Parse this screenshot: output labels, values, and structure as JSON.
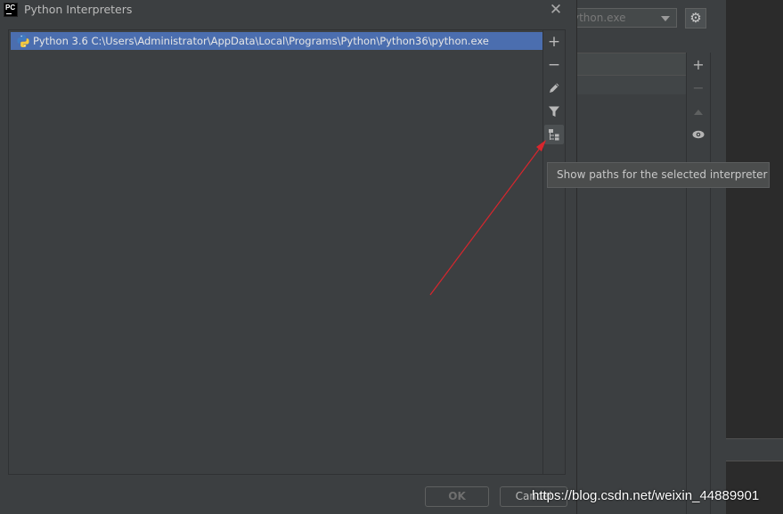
{
  "background_dialog": {
    "interpreter_combo_value": "ython.exe",
    "gear_icon": "gear-icon",
    "toolbar_icons": [
      "plus-icon",
      "minus-icon",
      "up-arrow-icon",
      "eye-icon"
    ]
  },
  "dialog": {
    "title": "Python Interpreters",
    "logo_text": "PC",
    "close_glyph": "✕"
  },
  "interpreters": [
    {
      "label": "Python 3.6 C:\\Users\\Administrator\\AppData\\Local\\Programs\\Python\\Python36\\python.exe",
      "selected": true,
      "icon": "python-icon"
    }
  ],
  "toolbar": {
    "add": "+",
    "remove": "−",
    "edit_icon": "pencil-icon",
    "filter_icon": "filter-icon",
    "paths_icon": "tree-paths-icon"
  },
  "tooltip": {
    "text": "Show paths for the selected interpreter"
  },
  "footer": {
    "ok_label": "OK",
    "cancel_label": "Cancel"
  },
  "watermark": "https://blog.csdn.net/weixin_44889901",
  "colors": {
    "selection": "#4b6eaf",
    "panel": "#3c3f41",
    "annotation_arrow": "#d8262d"
  }
}
